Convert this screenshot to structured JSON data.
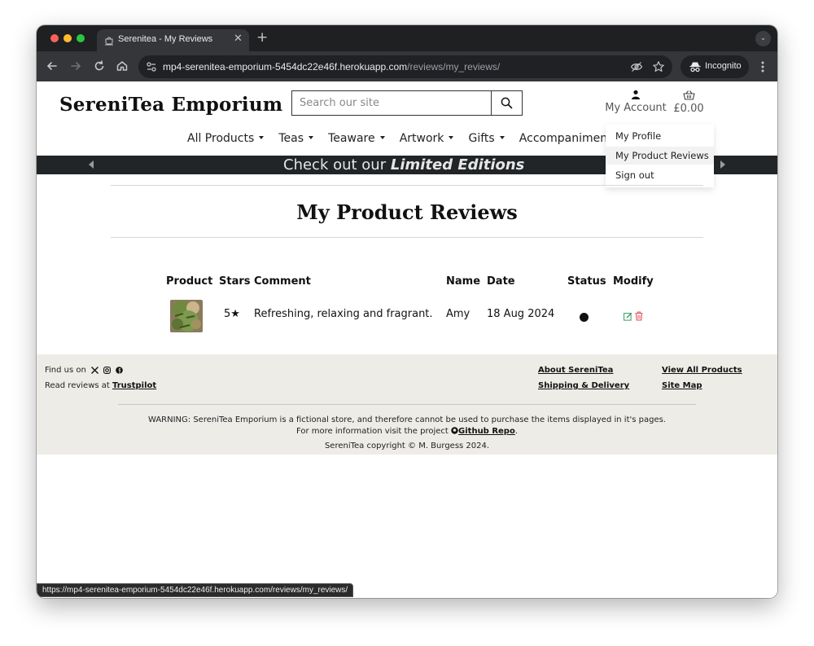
{
  "browser": {
    "tab_title": "Serenitea - My Reviews",
    "url_host": "mp4-serenitea-emporium-5454dc22e46f.herokuapp.com",
    "url_path": "/reviews/my_reviews/",
    "incognito_label": "Incognito",
    "status_url": "https://mp4-serenitea-emporium-5454dc22e46f.herokuapp.com/reviews/my_reviews/"
  },
  "header": {
    "brand": "SereniTea Emporium",
    "search_placeholder": "Search our site",
    "account_label": "My Account",
    "bag_total": "£0.00"
  },
  "nav": {
    "items": [
      "All Products",
      "Teas",
      "Teaware",
      "Artwork",
      "Gifts",
      "Accompaniments"
    ]
  },
  "account_menu": {
    "items": [
      "My Profile",
      "My Product Reviews",
      "Sign out"
    ],
    "active_index": 1
  },
  "banner": {
    "prefix": "Check out our ",
    "highlight": "Limited Editions"
  },
  "main": {
    "title": "My Product Reviews",
    "columns": [
      "Product",
      "Stars",
      "Comment",
      "Name",
      "Date",
      "Status",
      "Modify"
    ],
    "rows": [
      {
        "stars": "5",
        "comment": "Refreshing, relaxing and fragrant.",
        "name": "Amy",
        "date": "18 Aug 2024"
      }
    ]
  },
  "footer": {
    "find_us": "Find us on",
    "read_reviews": "Read reviews at",
    "trustpilot": "Trustpilot",
    "about": "About SereniTea",
    "shipping": "Shipping & Delivery",
    "view_all": "View All Products",
    "site_map": "Site Map",
    "warning": "WARNING: SereniTea Emporium is a fictional store, and therefore cannot be used to purchase the items displayed in it's pages.",
    "more_info": "For more information visit the project",
    "github": "Github Repo",
    "copyright": "SereniTea copyright © M. Burgess 2024."
  },
  "colors": {
    "chrome_dark": "#1f2022",
    "toolbar": "#35363a",
    "banner_bg": "#222528",
    "footer_bg": "#eeece7",
    "delete_red": "#e0515a",
    "edit_green": "#3a9a5a"
  }
}
